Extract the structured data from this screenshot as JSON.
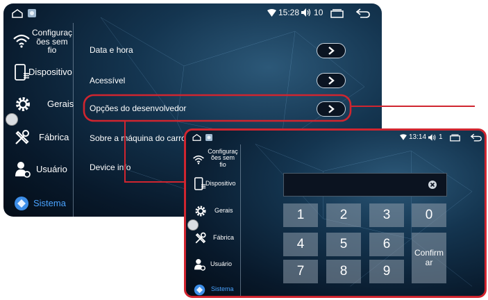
{
  "colors": {
    "highlight": "#d0252f",
    "active": "#4aa3ff"
  },
  "main": {
    "status": {
      "time": "15:28",
      "volume": "10",
      "icons": [
        "home-icon",
        "app-icon",
        "wifi-icon",
        "volume-icon",
        "recents-icon",
        "back-icon"
      ]
    },
    "sidebar": [
      {
        "label": "Configurações sem fio",
        "lines": [
          "Configuraç",
          "ões sem",
          "fio"
        ],
        "icon": "wifi-icon"
      },
      {
        "label": "Dispositivo",
        "lines": [
          "Dispositivo"
        ],
        "icon": "device-icon"
      },
      {
        "label": "Gerais",
        "lines": [
          "Gerais"
        ],
        "icon": "gear-icon"
      },
      {
        "label": "Fábrica",
        "lines": [
          "Fábrica"
        ],
        "icon": "tools-icon"
      },
      {
        "label": "Usuário",
        "lines": [
          "Usuário"
        ],
        "icon": "user-icon"
      },
      {
        "label": "Sistema",
        "lines": [
          "Sistema"
        ],
        "icon": "system-icon",
        "active": true
      }
    ],
    "menu": [
      {
        "label": "Data e hora",
        "has_arrow": true
      },
      {
        "label": "Acessível",
        "has_arrow": true
      },
      {
        "label": "Opções do desenvolvedor",
        "has_arrow": true,
        "highlighted": true
      },
      {
        "label": "Sobre a máquina do carro",
        "has_arrow": false
      },
      {
        "label": "Device info",
        "has_arrow": false
      }
    ]
  },
  "inset": {
    "status": {
      "time": "13:14",
      "volume": "1"
    },
    "sidebar": [
      {
        "lines": [
          "Configuraç",
          "ões sem",
          "fio"
        ],
        "icon": "wifi-icon"
      },
      {
        "lines": [
          "Dispositivo"
        ],
        "icon": "device-icon"
      },
      {
        "lines": [
          "Gerais"
        ],
        "icon": "gear-icon"
      },
      {
        "lines": [
          "Fábrica"
        ],
        "icon": "tools-icon"
      },
      {
        "lines": [
          "Usuário"
        ],
        "icon": "user-icon"
      },
      {
        "lines": [
          "Sistema"
        ],
        "icon": "system-icon",
        "active": true
      }
    ],
    "password_field": {
      "value": "",
      "clear_icon": "clear-icon"
    },
    "keypad": {
      "row1": [
        "1",
        "2",
        "3",
        "0"
      ],
      "row2": [
        "4",
        "5",
        "6"
      ],
      "row3": [
        "7",
        "8",
        "9"
      ],
      "confirm": [
        "Confirm",
        "ar"
      ]
    }
  }
}
